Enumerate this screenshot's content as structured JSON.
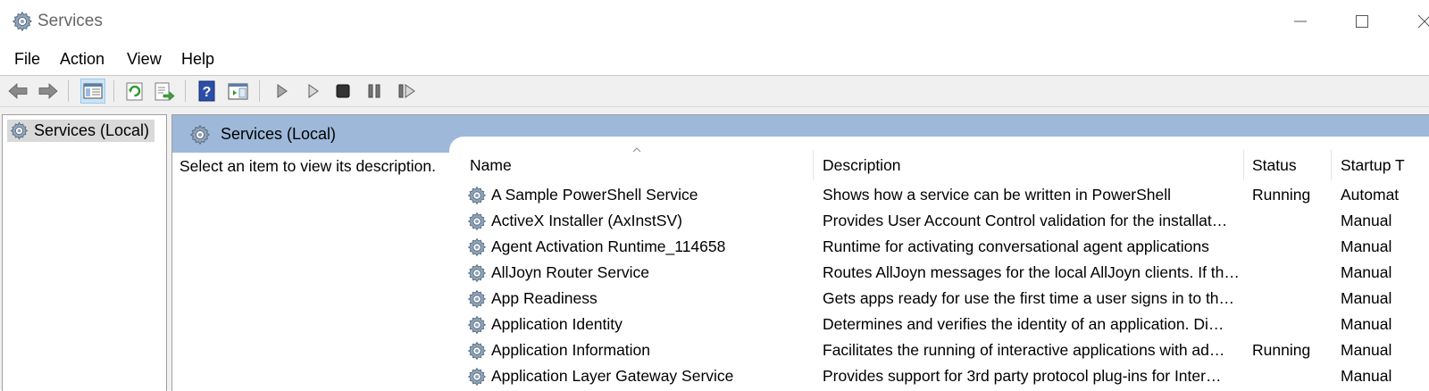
{
  "window": {
    "title": "Services",
    "controls": [
      "minimize-icon",
      "maximize-icon",
      "close-icon"
    ]
  },
  "menu": {
    "items": [
      "File",
      "Action",
      "View",
      "Help"
    ]
  },
  "toolbar": {
    "buttons": [
      "back-arrow-icon",
      "forward-arrow-icon",
      "show-hide-console-tree-icon",
      "refresh-icon",
      "export-list-icon",
      "help-icon",
      "properties-pane-icon",
      "start-service-icon",
      "start-service-alt-icon",
      "stop-service-icon",
      "pause-service-icon",
      "restart-service-icon"
    ]
  },
  "tree": {
    "selected_label": "Services (Local)"
  },
  "content": {
    "banner_title": "Services (Local)",
    "description_hint": "Select an item to view its description."
  },
  "list": {
    "columns": [
      "Name",
      "Description",
      "Status",
      "Startup T"
    ],
    "rows": [
      {
        "name": "A Sample PowerShell Service",
        "description": "Shows how a service can be written in PowerShell",
        "status": "Running",
        "startup": "Automat"
      },
      {
        "name": "ActiveX Installer (AxInstSV)",
        "description": "Provides User Account Control validation for the installat…",
        "status": "",
        "startup": "Manual"
      },
      {
        "name": "Agent Activation Runtime_114658",
        "description": "Runtime for activating conversational agent applications",
        "status": "",
        "startup": "Manual"
      },
      {
        "name": "AllJoyn Router Service",
        "description": "Routes AllJoyn messages for the local AllJoyn clients. If th…",
        "status": "",
        "startup": "Manual"
      },
      {
        "name": "App Readiness",
        "description": "Gets apps ready for use the first time a user signs in to th…",
        "status": "",
        "startup": "Manual"
      },
      {
        "name": "Application Identity",
        "description": "Determines and verifies the identity of an application. Di…",
        "status": "",
        "startup": "Manual"
      },
      {
        "name": "Application Information",
        "description": "Facilitates the running of interactive applications with ad…",
        "status": "Running",
        "startup": "Manual"
      },
      {
        "name": "Application Layer Gateway Service",
        "description": "Provides support for 3rd party protocol plug-ins for Inter…",
        "status": "",
        "startup": "Manual"
      }
    ]
  },
  "colors": {
    "banner": "#9db8d9",
    "selection": "#d9d9d9",
    "toolbar_bg": "#f0f0f0"
  }
}
